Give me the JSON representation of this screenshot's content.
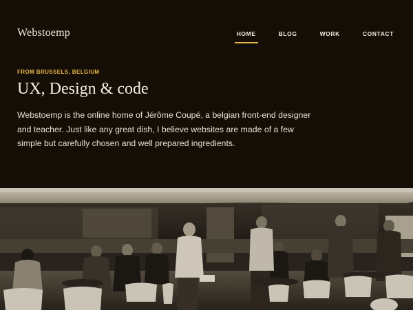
{
  "site": {
    "logo": "Webstoemp"
  },
  "nav": {
    "items": [
      {
        "label": "HOME",
        "active": true
      },
      {
        "label": "BLOG",
        "active": false
      },
      {
        "label": "WORK",
        "active": false
      },
      {
        "label": "CONTACT",
        "active": false
      }
    ]
  },
  "hero": {
    "kicker": "FROM BRUSSELS, BELGIUM",
    "title": "UX, Design & code",
    "intro": "Webstoemp is the online home of Jérôme Coupé, a belgian front-end designer and teacher. Just like any great dish, I believe websites are made of a few simple but carefully chosen and well prepared ingredients."
  },
  "colors": {
    "background": "#140e06",
    "accent": "#e8b94a",
    "text": "#f3ece0"
  }
}
